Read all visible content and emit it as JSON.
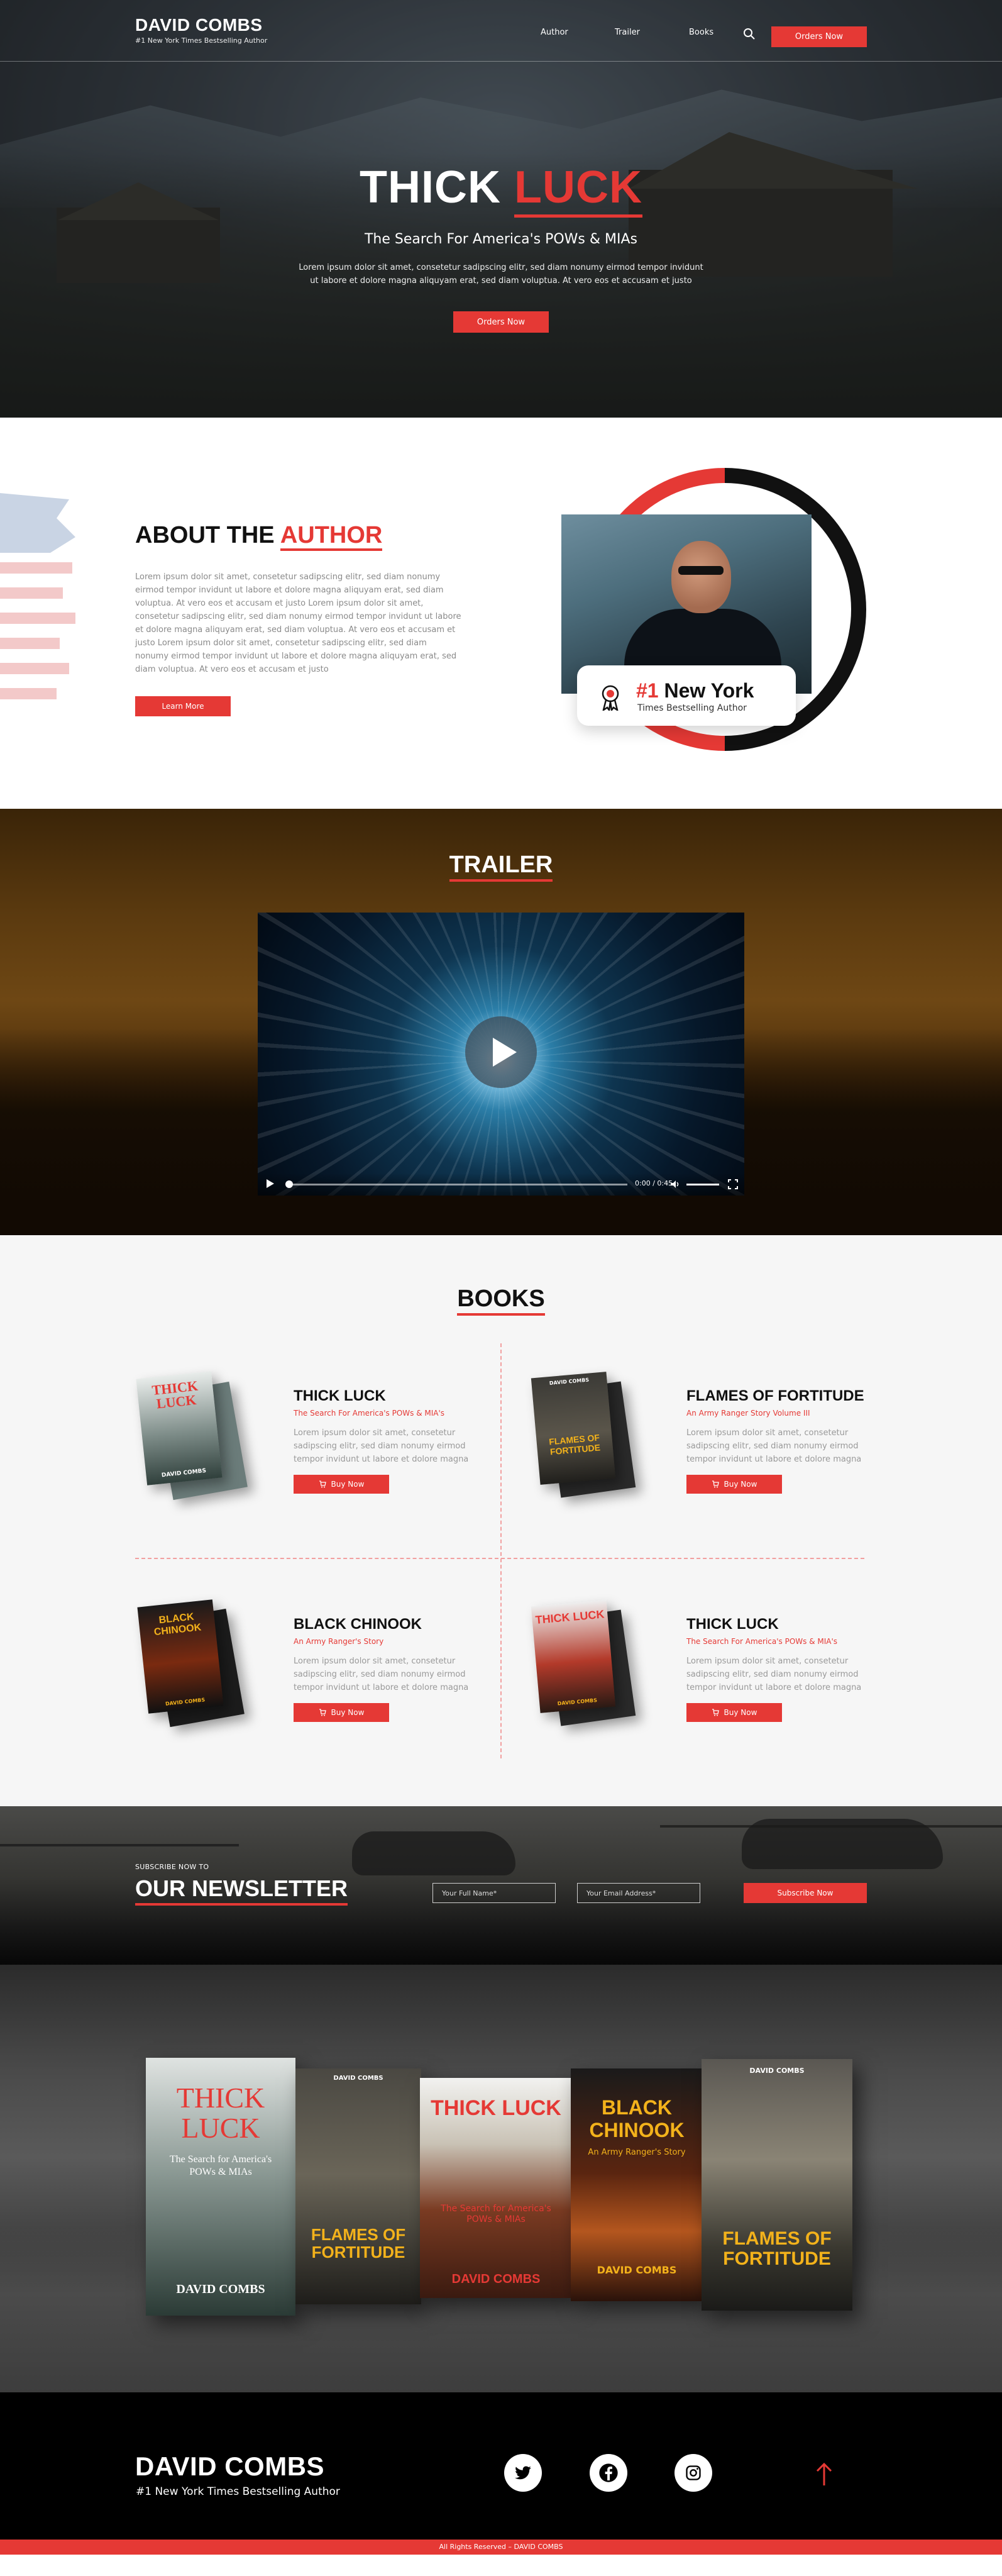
{
  "brand": {
    "name": "DAVID COMBS",
    "tagline": "#1 New York Times Bestselling Author"
  },
  "nav": {
    "items": [
      "Author",
      "Trailer",
      "Books"
    ],
    "order_label": "Orders Now"
  },
  "hero": {
    "title_part1": "THICK",
    "title_part2": "LUCK",
    "subtitle": "The Search For America's POWs & MIAs",
    "description": "Lorem ipsum dolor sit amet, consetetur sadipscing elitr, sed diam nonumy eirmod tempor invidunt ut labore et dolore magna aliquyam erat, sed diam voluptua. At vero eos et accusam et justo",
    "cta": "Orders Now"
  },
  "about": {
    "title_part1": "ABOUT THE",
    "title_part2": "AUTHOR",
    "text": "Lorem ipsum dolor sit amet, consetetur sadipscing elitr, sed diam nonumy eirmod tempor invidunt ut labore et dolore magna aliquyam erat, sed diam voluptua. At vero eos et accusam et justo Lorem ipsum dolor sit amet, consetetur sadipscing elitr, sed diam nonumy eirmod tempor invidunt ut labore et dolore magna aliquyam erat, sed diam voluptua. At vero eos et accusam et justo Lorem ipsum dolor sit amet, consetetur sadipscing elitr, sed diam nonumy eirmod tempor invidunt ut labore et dolore magna aliquyam erat, sed diam voluptua. At vero eos et accusam et justo",
    "button": "Learn More",
    "award_rank": "#1",
    "award_place": "New York",
    "award_sub": "Times Bestselling Author"
  },
  "trailer": {
    "title": "TRAILER",
    "time": "0:00 / 0:45",
    "progress": 0
  },
  "books": {
    "title": "BOOKS",
    "buy_label": "Buy Now",
    "items": [
      {
        "title": "THICK LUCK",
        "tagline": "The Search For America's POWs & MIA's",
        "desc": "Lorem ipsum dolor sit amet, consetetur sadipscing elitr, sed diam nonumy eirmod tempor invidunt ut labore et dolore magna",
        "cover_title": "THICK LUCK",
        "cover_author": "DAVID COMBS"
      },
      {
        "title": "FLAMES OF FORTITUDE",
        "tagline": "An Army Ranger Story Volume III",
        "desc": "Lorem ipsum dolor sit amet, consetetur sadipscing elitr, sed diam nonumy eirmod tempor invidunt ut labore et dolore magna",
        "cover_title": "FLAMES OF FORTITUDE",
        "cover_author": "DAVID COMBS"
      },
      {
        "title": "BLACK CHINOOK",
        "tagline": "An Army Ranger's Story",
        "desc": "Lorem ipsum dolor sit amet, consetetur sadipscing elitr, sed diam nonumy eirmod tempor invidunt ut labore et dolore magna",
        "cover_title": "BLACK CHINOOK",
        "cover_author": "DAVID COMBS"
      },
      {
        "title": "THICK LUCK",
        "tagline": "The Search For America's POWs & MIA's",
        "desc": "Lorem ipsum dolor sit amet, consetetur sadipscing elitr, sed diam nonumy eirmod tempor invidunt ut labore et dolore magna",
        "cover_title": "THICK LUCK",
        "cover_author": "DAVID COMBS"
      }
    ]
  },
  "newsletter": {
    "kicker": "SUBSCRIBE NOW TO",
    "title": "OUR NEWSLETTER",
    "name_placeholder": "Your Full Name*",
    "email_placeholder": "Your Email Address*",
    "button": "Subscribe Now"
  },
  "showcase": {
    "books": [
      {
        "title": "THICK LUCK",
        "subtitle": "The Search for America's POWs & MIAs",
        "author": "DAVID COMBS"
      },
      {
        "title": "FLAMES OF FORTITUDE",
        "subtitle": "",
        "author": "DAVID COMBS"
      },
      {
        "title": "THICK LUCK",
        "subtitle": "The Search for America's POWs & MIAs",
        "author": "DAVID COMBS"
      },
      {
        "title": "BLACK CHINOOK",
        "subtitle": "An Army Ranger's Story",
        "author": "DAVID COMBS"
      },
      {
        "title": "FLAMES OF FORTITUDE",
        "subtitle": "",
        "author": "DAVID COMBS"
      }
    ]
  },
  "footer": {
    "name": "DAVID COMBS",
    "tagline": "#1 New York Times Bestselling Author",
    "social": [
      "twitter-icon",
      "facebook-icon",
      "instagram-icon"
    ],
    "copyright": "All Rights Reserved – DAVID COMBS"
  },
  "colors": {
    "accent": "#e53935",
    "dark": "#111111",
    "muted_text": "#8a8a8a"
  }
}
